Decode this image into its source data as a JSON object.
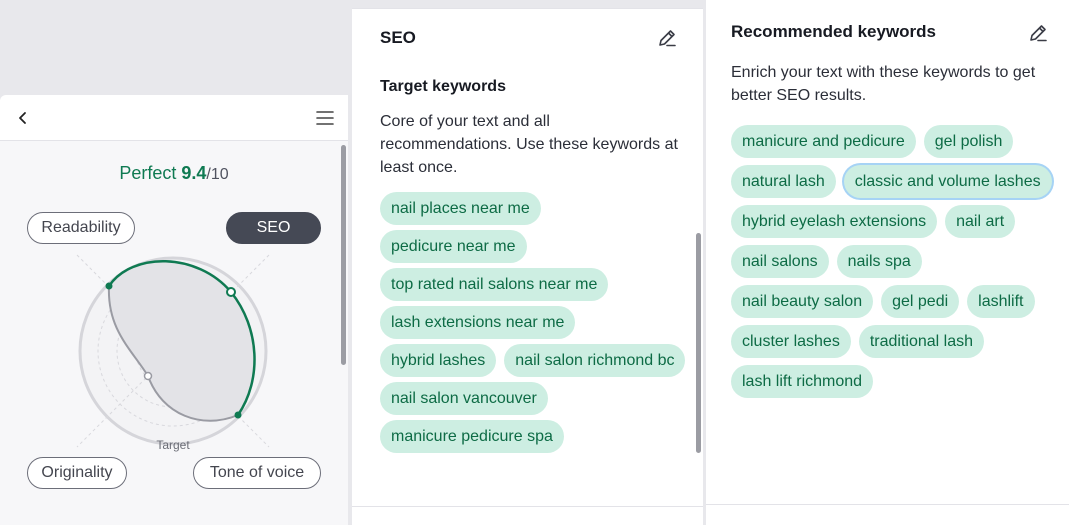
{
  "score_panel": {
    "score_prefix": "Perfect",
    "score_value": "9.4",
    "score_suffix": "/10",
    "pills": {
      "readability": "Readability",
      "seo": "SEO",
      "originality": "Originality",
      "tone": "Tone of voice"
    },
    "radar_target_label": "Target",
    "icons": {
      "back": "chevron-left-icon",
      "menu": "hamburger-menu-icon"
    },
    "accent_color": "#0f7a52"
  },
  "seo_panel": {
    "title": "SEO",
    "subhead": "Target keywords",
    "description": "Core of your text and all recommendations. Use these keywords at least once.",
    "keywords": [
      "nail places near me",
      "pedicure near me",
      "top rated nail salons near me",
      "lash extensions near me",
      "hybrid lashes",
      "nail salon richmond bc",
      "nail salon vancouver",
      "manicure pedicure spa"
    ],
    "icons": {
      "edit": "pencil-icon"
    }
  },
  "recommended_panel": {
    "title": "Recommended keywords",
    "description": "Enrich your text with these keywords to get better SEO results.",
    "keywords": [
      "manicure and pedicure",
      "gel polish",
      "natural lash",
      "classic and volume lashes",
      "hybrid eyelash extensions",
      "nail art",
      "nail salons",
      "nails spa",
      "nail beauty salon",
      "gel pedi",
      "lashlift",
      "cluster lashes",
      "traditional lash",
      "lash lift richmond"
    ],
    "focused_keyword": "classic and volume lashes",
    "icons": {
      "edit": "pencil-icon"
    },
    "chip_color": "#cdeee2",
    "chip_text_color": "#0d6b45"
  }
}
